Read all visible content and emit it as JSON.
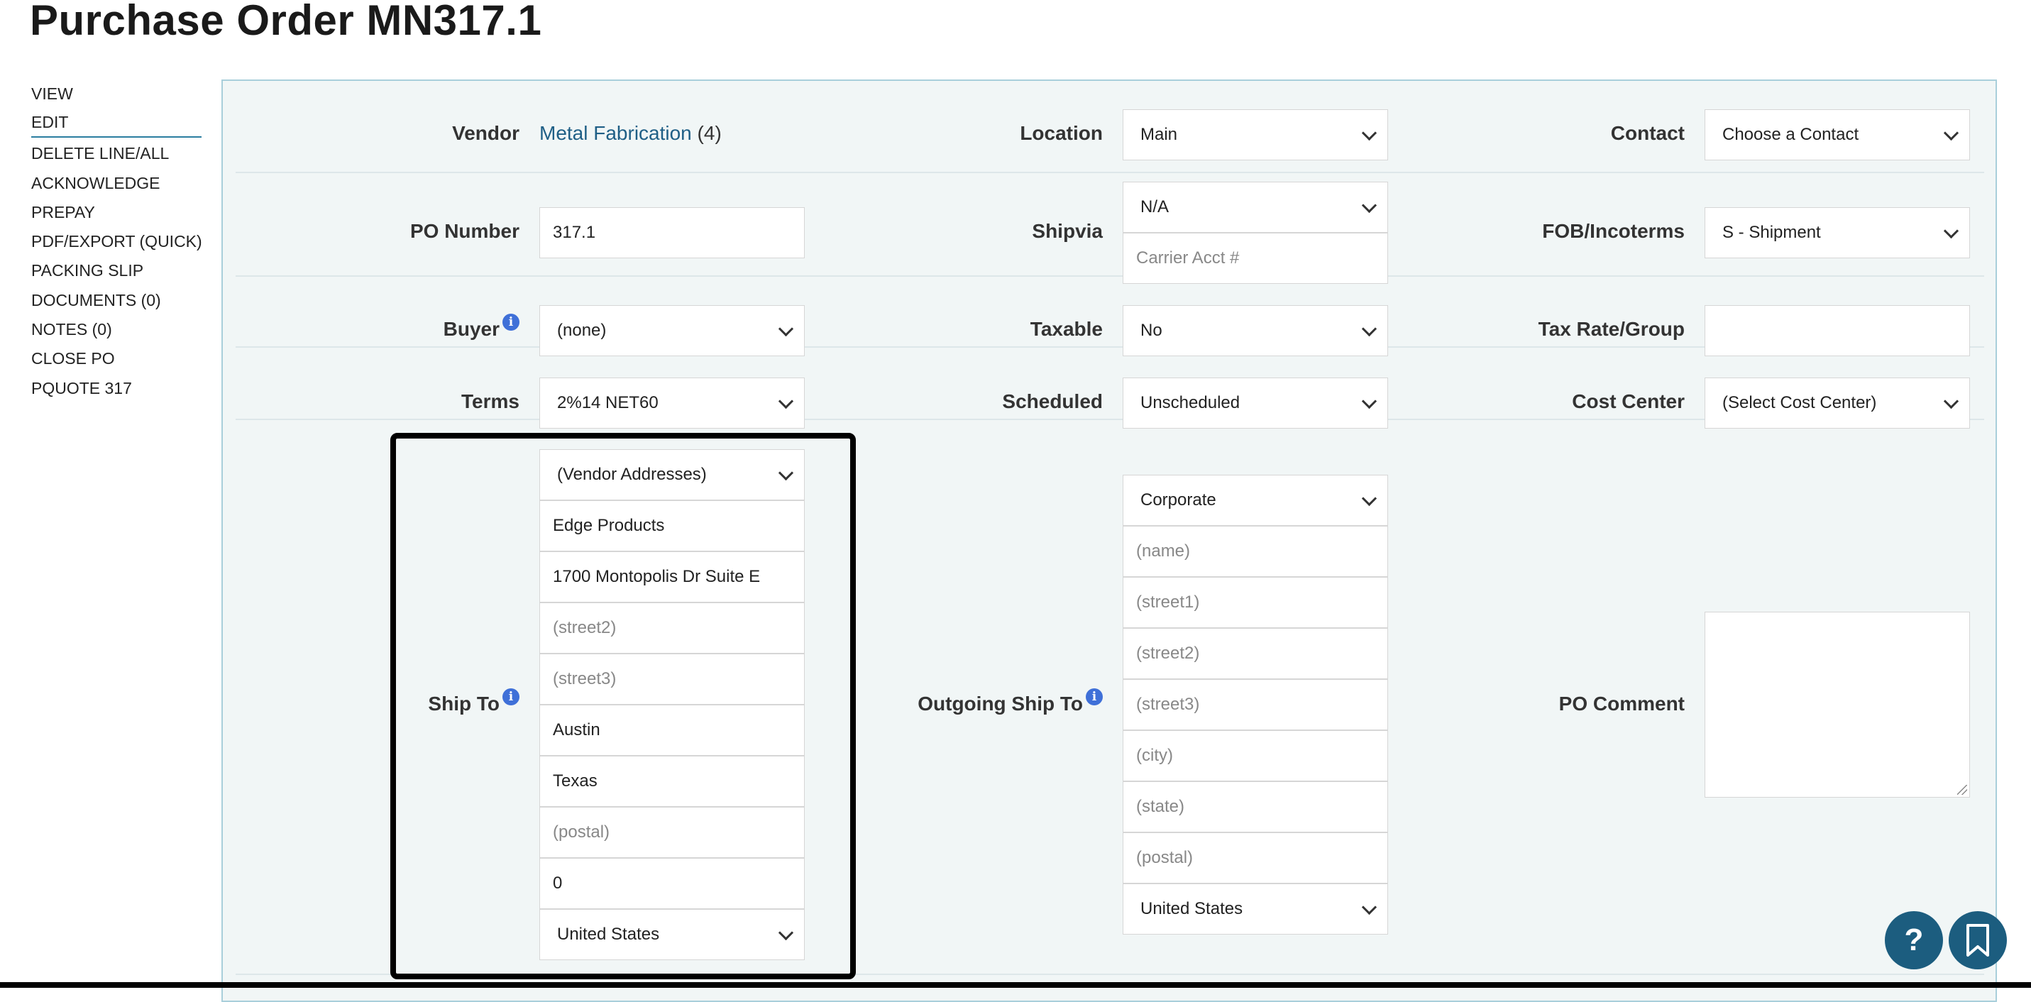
{
  "page": {
    "title": "Purchase Order MN317.1"
  },
  "menu": {
    "items": [
      {
        "label": "VIEW"
      },
      {
        "label": "EDIT"
      },
      {
        "label": "DELETE LINE/ALL"
      },
      {
        "label": "ACKNOWLEDGE"
      },
      {
        "label": "PREPAY"
      },
      {
        "label": "PDF/EXPORT (QUICK)"
      },
      {
        "label": "PACKING SLIP"
      },
      {
        "label": "DOCUMENTS (0)"
      },
      {
        "label": "NOTES (0)"
      },
      {
        "label": "CLOSE PO"
      },
      {
        "label": "PQUOTE 317"
      }
    ]
  },
  "form": {
    "vendor": {
      "label": "Vendor",
      "name": "Metal Fabrication",
      "count": "(4)"
    },
    "location": {
      "label": "Location",
      "value": "Main"
    },
    "contact": {
      "label": "Contact",
      "value": "Choose a Contact"
    },
    "po_number": {
      "label": "PO Number",
      "value": "317.1"
    },
    "shipvia": {
      "label": "Shipvia",
      "value": "N/A",
      "carrier_placeholder": "Carrier Acct #"
    },
    "fob": {
      "label": "FOB/Incoterms",
      "value": "S - Shipment"
    },
    "buyer": {
      "label": "Buyer",
      "value": "(none)"
    },
    "taxable": {
      "label": "Taxable",
      "value": "No"
    },
    "tax_rate": {
      "label": "Tax Rate/Group",
      "value": ""
    },
    "terms": {
      "label": "Terms",
      "value": "2%14 NET60"
    },
    "scheduled": {
      "label": "Scheduled",
      "value": "Unscheduled"
    },
    "cost_center": {
      "label": "Cost Center",
      "value": "(Select Cost Center)"
    },
    "ship_to": {
      "label": "Ship To",
      "address_select": "(Vendor Addresses)",
      "name": "Edge Products",
      "street1": "1700 Montopolis Dr Suite E",
      "street2_placeholder": "(street2)",
      "street3_placeholder": "(street3)",
      "city": "Austin",
      "state": "Texas",
      "postal_placeholder": "(postal)",
      "extra": "0",
      "country": "United States"
    },
    "outgoing_ship_to": {
      "label": "Outgoing Ship To",
      "address_select": "Corporate",
      "name_placeholder": "(name)",
      "street1_placeholder": "(street1)",
      "street2_placeholder": "(street2)",
      "street3_placeholder": "(street3)",
      "city_placeholder": "(city)",
      "state_placeholder": "(state)",
      "postal_placeholder": "(postal)",
      "country": "United States"
    },
    "po_comment": {
      "label": "PO Comment",
      "value": ""
    }
  },
  "info_glyph": "i",
  "fab": {
    "help_glyph": "?"
  },
  "icons": {
    "info": "info-icon",
    "help": "question-icon",
    "bookmark": "bookmark-icon",
    "dropdown": "chevron-down-icon"
  }
}
